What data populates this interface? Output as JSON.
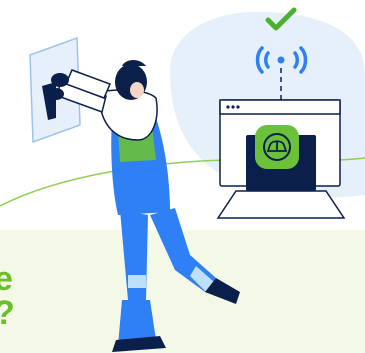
{
  "illustration": {
    "visible_text_fragments": [
      "e",
      "?"
    ],
    "check_icon": "check-icon",
    "wifi_icon": "signal-broadcast-icon",
    "router_icon": "router-icon",
    "colors": {
      "accent_green": "#66bd2b",
      "navy": "#0b1f4b",
      "blue": "#2f7ff5",
      "light_blue": "#e6f0fb",
      "pale_green": "#f3f8e7"
    }
  }
}
